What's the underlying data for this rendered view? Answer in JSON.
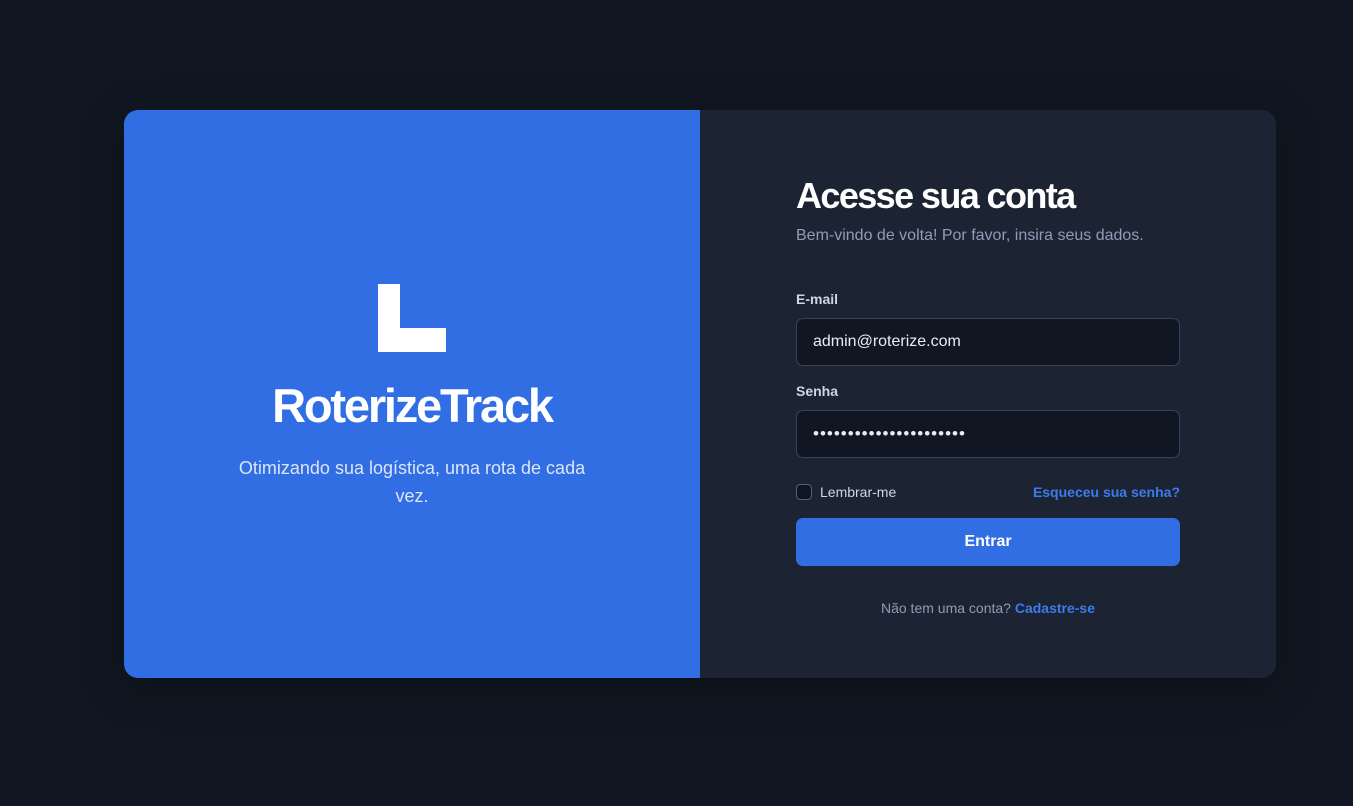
{
  "brand": {
    "logo_icon": "step-blocks-logo-icon",
    "name": "RoterizeTrack",
    "tagline": "Otimizando sua logística, uma rota de cada vez."
  },
  "login": {
    "title": "Acesse sua conta",
    "subtitle": "Bem-vindo de volta! Por favor, insira seus dados.",
    "email_label": "E-mail",
    "email_value": "admin@roterize.com",
    "password_label": "Senha",
    "password_value": "••••••••••••••••••••••",
    "remember_label": "Lembrar-me",
    "remember_checked": false,
    "forgot_label": "Esqueceu sua senha?",
    "submit_label": "Entrar",
    "signup_prompt": "Não tem uma conta? ",
    "signup_link": "Cadastre-se"
  },
  "colors": {
    "page_bg": "#111722",
    "brand_panel": "#316ee4",
    "form_panel": "#1c2434",
    "accent_link": "#3b7bea",
    "input_bg": "#111722"
  }
}
